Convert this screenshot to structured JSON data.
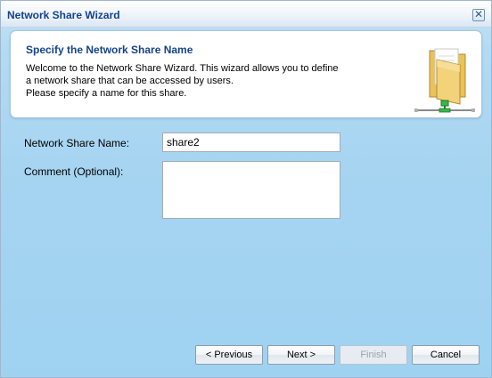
{
  "window": {
    "title": "Network Share Wizard",
    "close_glyph": "✕"
  },
  "header": {
    "title": "Specify the Network Share Name",
    "lines": [
      "Welcome to the Network Share Wizard. This wizard allows you to define",
      "a network share that can be accessed by users.",
      "Please specify a name for this share."
    ],
    "icon": "network-folder-icon"
  },
  "form": {
    "name_label": "Network Share Name:",
    "name_value": "share2",
    "comment_label": "Comment (Optional):",
    "comment_value": ""
  },
  "buttons": {
    "previous": "< Previous",
    "next": "Next >",
    "finish": "Finish",
    "cancel": "Cancel"
  },
  "colors": {
    "title_text": "#15428b",
    "background": "#a5d4f1"
  }
}
